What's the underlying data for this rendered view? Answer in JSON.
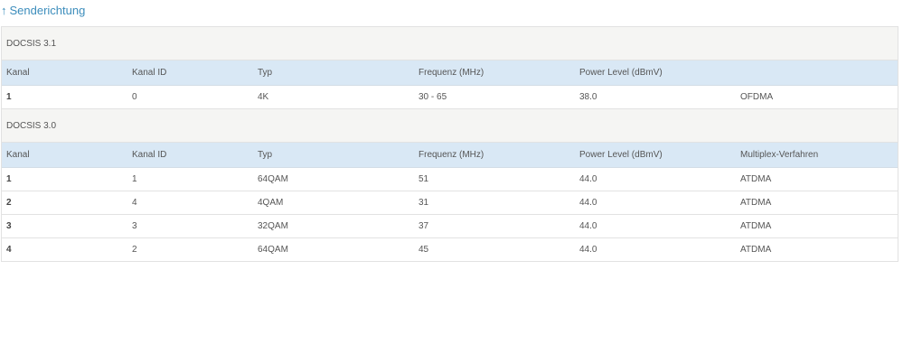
{
  "heading": {
    "arrow": "↑",
    "title": "Senderichtung"
  },
  "sections": [
    {
      "title": "DOCSIS 3.1",
      "columns": [
        "Kanal",
        "Kanal ID",
        "Typ",
        "Frequenz (MHz)",
        "Power Level (dBmV)",
        ""
      ],
      "rows": [
        [
          "1",
          "0",
          "4K",
          "30 - 65",
          "38.0",
          "OFDMA"
        ]
      ]
    },
    {
      "title": "DOCSIS 3.0",
      "columns": [
        "Kanal",
        "Kanal ID",
        "Typ",
        "Frequenz (MHz)",
        "Power Level (dBmV)",
        "Multiplex-Verfahren"
      ],
      "rows": [
        [
          "1",
          "1",
          "64QAM",
          "51",
          "44.0",
          "ATDMA"
        ],
        [
          "2",
          "4",
          "4QAM",
          "31",
          "44.0",
          "ATDMA"
        ],
        [
          "3",
          "3",
          "32QAM",
          "37",
          "44.0",
          "ATDMA"
        ],
        [
          "4",
          "2",
          "64QAM",
          "45",
          "44.0",
          "ATDMA"
        ]
      ]
    }
  ]
}
